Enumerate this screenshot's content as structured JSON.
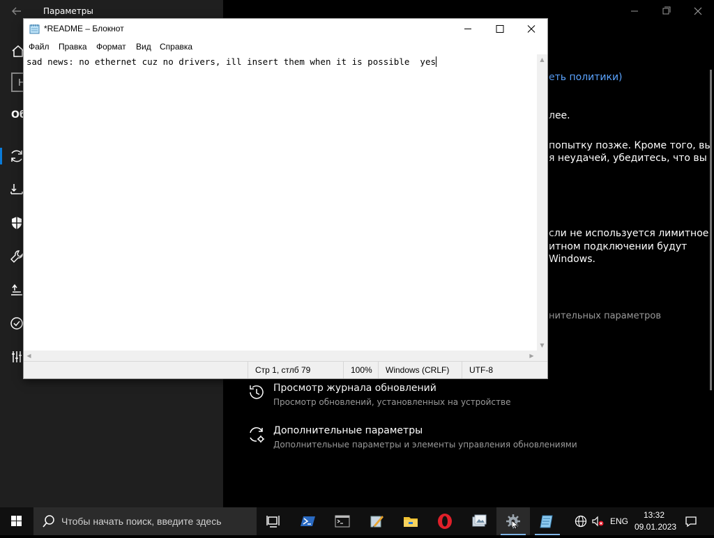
{
  "settings": {
    "title": "Параметры",
    "search_placeholder": "Н",
    "heading": "Об",
    "fragments": {
      "policy_link": "еть политики)",
      "line1": "лее.",
      "line2": "попытку позже. Кроме того, вы",
      "line3": "я неудачей, убедитесь, что вы",
      "line4": "сли не используется лимитное",
      "line5": "итном подключении будут",
      "line6": "Windows.",
      "line7": "нительных параметров"
    },
    "options": [
      {
        "title": "Просмотр журнала обновлений",
        "subtitle": "Просмотр обновлений, установленных на устройстве"
      },
      {
        "title": "Дополнительные параметры",
        "subtitle": "Дополнительные параметры и элементы управления обновлениями"
      }
    ]
  },
  "notepad": {
    "title": "*README – Блокнот",
    "menu": [
      "Файл",
      "Правка",
      "Формат",
      "Вид",
      "Справка"
    ],
    "content": "sad news: no ethernet cuz no drivers, ill insert them when it is possible  yes",
    "status": {
      "position": "Стр 1, стлб 79",
      "zoom": "100%",
      "line_ending": "Windows (CRLF)",
      "encoding": "UTF-8"
    }
  },
  "taskbar": {
    "search_placeholder": "Чтобы начать поиск, введите здесь",
    "apps": [
      "task-view",
      "powershell",
      "command-prompt",
      "app-pen",
      "file-explorer",
      "opera",
      "photos",
      "settings",
      "notepad"
    ],
    "tray": {
      "language": "ENG",
      "time": "13:32",
      "date": "09.01.2023"
    }
  },
  "colors": {
    "accent_link": "#5aa3ff",
    "taskbar_bg": "#101010",
    "sidebar_bg": "#1f1f1f",
    "opera_red": "#e0202a"
  }
}
